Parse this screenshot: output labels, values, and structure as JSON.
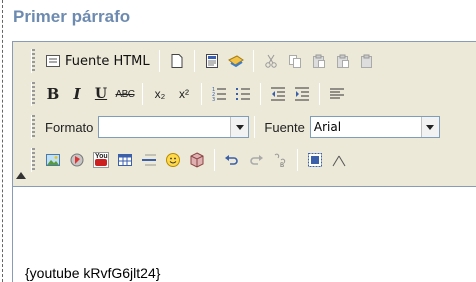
{
  "section_title": "Primer párrafo",
  "toolbar": {
    "row1": {
      "source_html_label": "Fuente HTML",
      "icons": [
        "source-icon",
        "new-page-icon",
        "preview-icon",
        "templates-icon",
        "cut-icon",
        "copy-icon",
        "paste-icon",
        "paste-text-icon",
        "paste-word-icon"
      ]
    },
    "row2": {
      "bold": "B",
      "italic": "I",
      "underline": "U",
      "strike": "ABC",
      "subscript": "x₂",
      "superscript": "x²"
    },
    "row3": {
      "format_label": "Formato",
      "format_value": "",
      "font_label": "Fuente",
      "font_value": "Arial"
    },
    "row4": {
      "icons": [
        "image-icon",
        "flash-icon",
        "youtube-icon",
        "table-icon",
        "horizontal-rule-icon",
        "smiley-icon",
        "special-char-icon",
        "undo-icon",
        "redo-icon",
        "find-replace-icon",
        "select-all-icon",
        "remove-format-icon"
      ],
      "youtube_text": "You"
    }
  },
  "content": {
    "text": "{youtube kRvfG6jlt24}"
  }
}
